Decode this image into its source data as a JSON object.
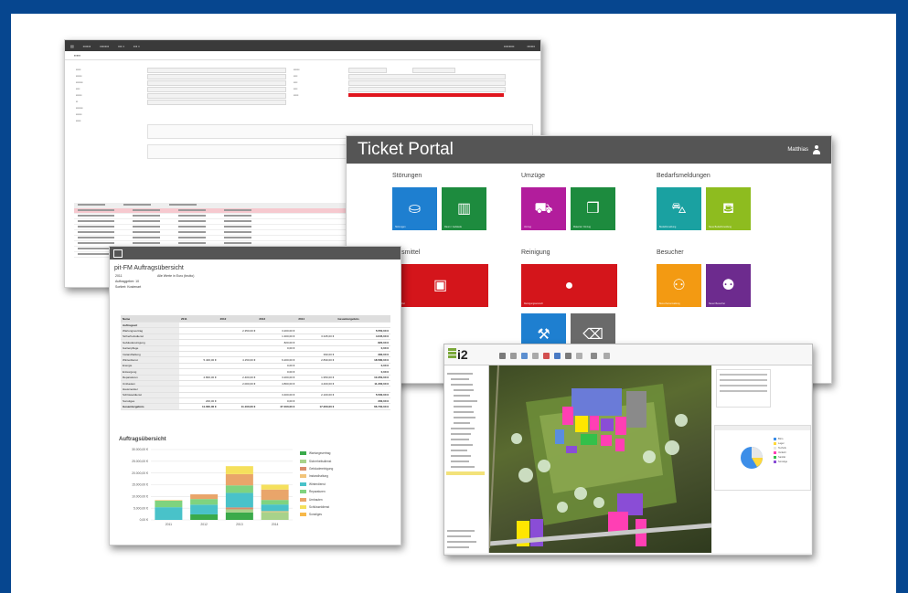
{
  "colors": {
    "frame": "#06468f",
    "portal_header": "#555555",
    "tile_blue": "#1e7fd0",
    "tile_green": "#1d8b3e",
    "tile_magenta": "#b21d9c",
    "tile_teal": "#1aa1a1",
    "tile_lime": "#8ebc1f",
    "tile_red": "#d4151b",
    "tile_orange": "#f39a12",
    "tile_purple": "#6d2b8e",
    "tile_navy": "#233f9a",
    "tile_gray": "#6a6a6a"
  },
  "portal": {
    "title": "Ticket Portal",
    "user": "Matthias",
    "groups": [
      {
        "title": "Störungen",
        "tiles": [
          {
            "icon": "desk-icon",
            "color": "#1e7fd0",
            "label": "Störungen"
          },
          {
            "icon": "building-icon",
            "color": "#1d8b3e",
            "label": "Raum / Gebäude"
          }
        ]
      },
      {
        "title": "Umzüge",
        "tiles": [
          {
            "icon": "dolly-icon",
            "color": "#b21d9c",
            "label": "Umzug"
          },
          {
            "icon": "box-icon",
            "color": "#1d8b3e",
            "label": "Material / Umzug"
          }
        ]
      },
      {
        "title": "Bedarfsmeldungen",
        "tiles": [
          {
            "icon": "cart-icon",
            "color": "#1aa1a1",
            "label": "Bedarfsmeldung"
          },
          {
            "icon": "basket-icon",
            "color": "#8ebc1f",
            "label": "Neue Bedarfsmeldung"
          }
        ]
      },
      {
        "title": "Hilfsmittel",
        "tiles": [
          {
            "icon": "toolbox-icon",
            "color": "#d4151b",
            "label": "Hilfsmittel"
          }
        ]
      },
      {
        "title": "Reinigung",
        "tiles": [
          {
            "icon": "drop-icon",
            "color": "#d4151b",
            "label": "Reinigungswunsch"
          }
        ]
      },
      {
        "title": "Besucher",
        "tiles": [
          {
            "icon": "visitors-icon",
            "color": "#f39a12",
            "label": "Besucherverwaltung"
          },
          {
            "icon": "visitor-add-icon",
            "color": "#6d2b8e",
            "label": "Neuer Besucher"
          }
        ]
      }
    ]
  },
  "report": {
    "title": "pit-FM Auftragsübersicht",
    "meta": [
      "2011",
      "Auftraggeber: 10",
      "Sortiert: Kostenart"
    ],
    "meta_right": "Alle Werte in Euro (brutto)",
    "columns": [
      "Name",
      "2011",
      "2012",
      "2013",
      "2014",
      "Gesamtergebnis"
    ],
    "section": "Auftragsart",
    "rows": [
      {
        "name": "Wartungsvertrag",
        "vals": [
          "",
          "2.350,00 €",
          "3.200,00 €",
          "",
          "5.550,00 €"
        ]
      },
      {
        "name": "Sicherheitsdienst",
        "vals": [
          "",
          "",
          "1.300,00 €",
          "3.345,00 €",
          "4.645,00 €"
        ]
      },
      {
        "name": "Gebäudereinigung",
        "vals": [
          "",
          "",
          "820,00 €",
          "",
          "820,00 €"
        ]
      },
      {
        "name": "Gartenpflege",
        "vals": [
          "",
          "",
          "0,00 €",
          "",
          "0,00 €"
        ]
      },
      {
        "name": "Instandhaltung",
        "vals": [
          "",
          "",
          "",
          "390,00 €",
          "390,00 €"
        ]
      },
      {
        "name": "Winterdienst",
        "vals": [
          "5.400,00 €",
          "4.150,00 €",
          "6.200,00 €",
          "2.830,00 €",
          "18.580,00 €"
        ]
      },
      {
        "name": "Energie",
        "vals": [
          "",
          "",
          "0,00 €",
          "",
          "0,00 €"
        ]
      },
      {
        "name": "Entsorgung",
        "vals": [
          "",
          "",
          "0,00 €",
          "",
          "0,00 €"
        ]
      },
      {
        "name": "Reparaturen",
        "vals": [
          "2.800,00 €",
          "2.400,00 €",
          "3.200,00 €",
          "1.950,00 €",
          "10.350,00 €"
        ]
      },
      {
        "name": "Umbauten",
        "vals": [
          "",
          "2.000,00 €",
          "4.800,00 €",
          "4.400,00 €",
          "11.200,00 €"
        ]
      },
      {
        "name": "Hausmeister",
        "vals": [
          "",
          "",
          "",
          "",
          ""
        ]
      },
      {
        "name": "Schlüsseldienst",
        "vals": [
          "",
          "",
          "3.400,00 €",
          "2.100,00 €",
          "5.500,00 €"
        ]
      },
      {
        "name": "Sonstiges",
        "vals": [
          "200,00 €",
          "",
          "0,00 €",
          "",
          "200,00 €"
        ]
      }
    ],
    "total": {
      "name": "Gesamtergebnis",
      "vals": [
        "11.000,00 €",
        "11.100,00 €",
        "27.400,00 €",
        "17.200,00 €",
        "66.700,00 €"
      ]
    }
  },
  "chart_data": {
    "type": "bar",
    "title": "Auftragsübersicht",
    "categories": [
      "2011",
      "2012",
      "2013",
      "2014"
    ],
    "ylim": [
      0,
      30000
    ],
    "yticks": [
      "30.000,00 €",
      "25.000,00 €",
      "20.000,00 €",
      "15.000,00 €",
      "10.000,00 €",
      "5.000,00 €",
      "0,00 €"
    ],
    "series": [
      {
        "name": "Wartungsvertrag",
        "color": "#3aaa4a",
        "values": [
          0,
          2350,
          3200,
          0
        ]
      },
      {
        "name": "Sicherheitsdienst",
        "color": "#a8d28a",
        "values": [
          0,
          0,
          1300,
          3345
        ]
      },
      {
        "name": "Gebäudereinigung",
        "color": "#d98c6b",
        "values": [
          0,
          0,
          820,
          0
        ]
      },
      {
        "name": "Instandhaltung",
        "color": "#f2c47a",
        "values": [
          0,
          0,
          0,
          390
        ]
      },
      {
        "name": "Winterdienst",
        "color": "#49c2c9",
        "values": [
          5400,
          4150,
          6200,
          2830
        ]
      },
      {
        "name": "Reparaturen",
        "color": "#7fd37f",
        "values": [
          2800,
          2400,
          3200,
          1950
        ]
      },
      {
        "name": "Umbauten",
        "color": "#e9a56a",
        "values": [
          0,
          2000,
          4800,
          4400
        ]
      },
      {
        "name": "Schlüsseldienst",
        "color": "#f5e05c",
        "values": [
          0,
          0,
          3400,
          2100
        ]
      },
      {
        "name": "Sonstiges",
        "color": "#f7b84a",
        "values": [
          200,
          0,
          0,
          0
        ]
      }
    ]
  },
  "map": {
    "logo": "i2",
    "legend_items": [
      "Büro",
      "Lager",
      "Technik",
      "Verkehr",
      "Sanitär",
      "Sonstige"
    ]
  }
}
